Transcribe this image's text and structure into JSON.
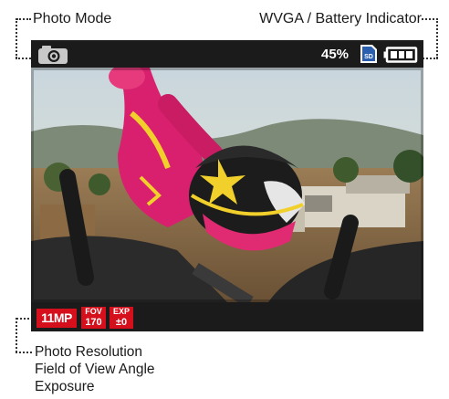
{
  "callouts": {
    "photo_mode": "Photo Mode",
    "wvga_battery": "WVGA / Battery Indicator",
    "bottom_lines": [
      "Photo Resolution",
      "Field of View Angle",
      "Exposure"
    ]
  },
  "screen": {
    "top_bar": {
      "mode_icon": "camera-icon",
      "battery_percent": "45%",
      "sd_label": "SD",
      "battery_icon": "battery-icon",
      "battery_level": 0.75
    },
    "bottom_bar": {
      "resolution": "11MP",
      "fov": {
        "label": "FOV",
        "value": "170"
      },
      "exposure": {
        "label": "EXP",
        "value": "±0"
      }
    },
    "photo_icon": "motocross-rider-photo"
  },
  "colors": {
    "screen_bg": "#1b1b1b",
    "badge_red": "#d5101c",
    "sd_blue": "#2a5fb0"
  }
}
